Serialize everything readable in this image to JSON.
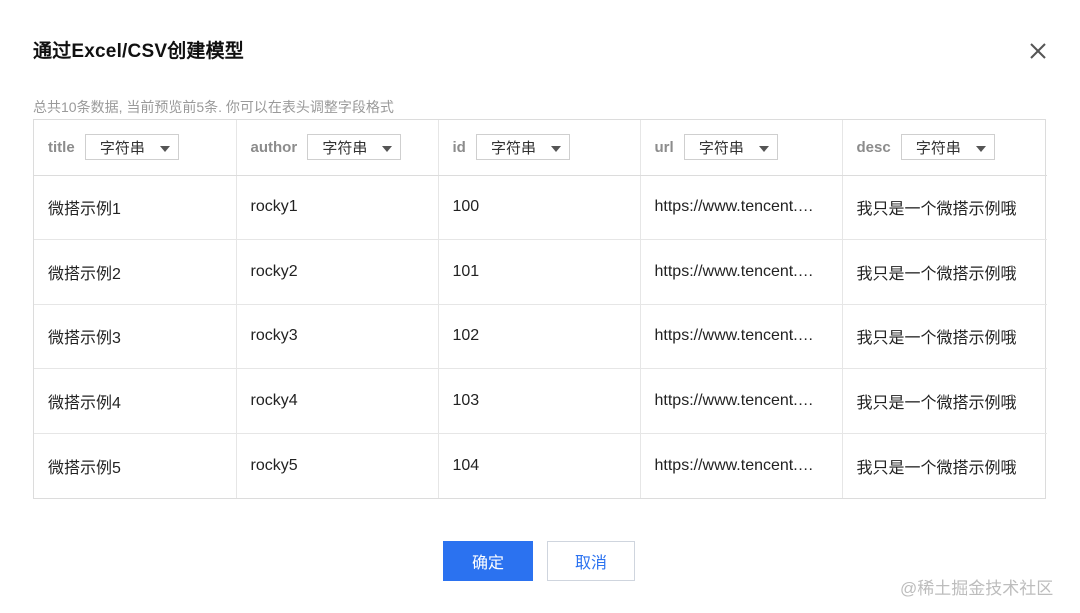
{
  "dialog": {
    "title": "通过Excel/CSV创建模型",
    "close_icon": "close-icon",
    "hint": "总共10条数据, 当前预览前5条. 你可以在表头调整字段格式"
  },
  "table": {
    "columns": [
      {
        "name": "title",
        "type": "字符串"
      },
      {
        "name": "author",
        "type": "字符串"
      },
      {
        "name": "id",
        "type": "字符串"
      },
      {
        "name": "url",
        "type": "字符串"
      },
      {
        "name": "desc",
        "type": "字符串"
      }
    ],
    "rows": [
      [
        "微搭示例1",
        "rocky1",
        "100",
        "https://www.tencent.…",
        "我只是一个微搭示例哦"
      ],
      [
        "微搭示例2",
        "rocky2",
        "101",
        "https://www.tencent.…",
        "我只是一个微搭示例哦"
      ],
      [
        "微搭示例3",
        "rocky3",
        "102",
        "https://www.tencent.…",
        "我只是一个微搭示例哦"
      ],
      [
        "微搭示例4",
        "rocky4",
        "103",
        "https://www.tencent.…",
        "我只是一个微搭示例哦"
      ],
      [
        "微搭示例5",
        "rocky5",
        "104",
        "https://www.tencent.…",
        "我只是一个微搭示例哦"
      ]
    ]
  },
  "footer": {
    "ok_label": "确定",
    "cancel_label": "取消"
  },
  "watermark": "@稀土掘金技术社区",
  "colors": {
    "primary": "#2b72f0",
    "muted_text": "#9a9a9a",
    "border": "#dcdcdc"
  }
}
